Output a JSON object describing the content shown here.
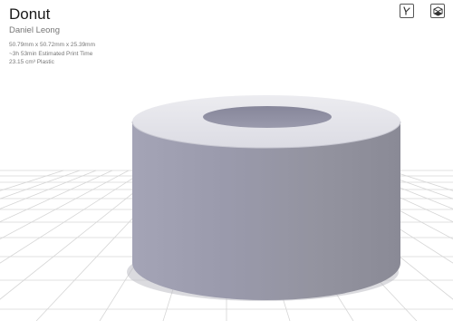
{
  "model": {
    "title": "Donut",
    "author": "Daniel Leong",
    "dimensions": "50.79mm x 50.72mm x 25.39mm",
    "print_time": "~3h 53min Estimated Print Time",
    "material": "23.15 cm³ Plastic"
  },
  "toolbar": {
    "buttons": [
      {
        "icon": "measure-axes-icon"
      },
      {
        "icon": "view-cube-icon"
      }
    ]
  },
  "colors": {
    "background": "#ffffff",
    "grid_line": "#d7d7d7",
    "model_body": "#9c9cae",
    "model_top": "#e4e4ea",
    "model_hole": "#8f8f9f"
  }
}
